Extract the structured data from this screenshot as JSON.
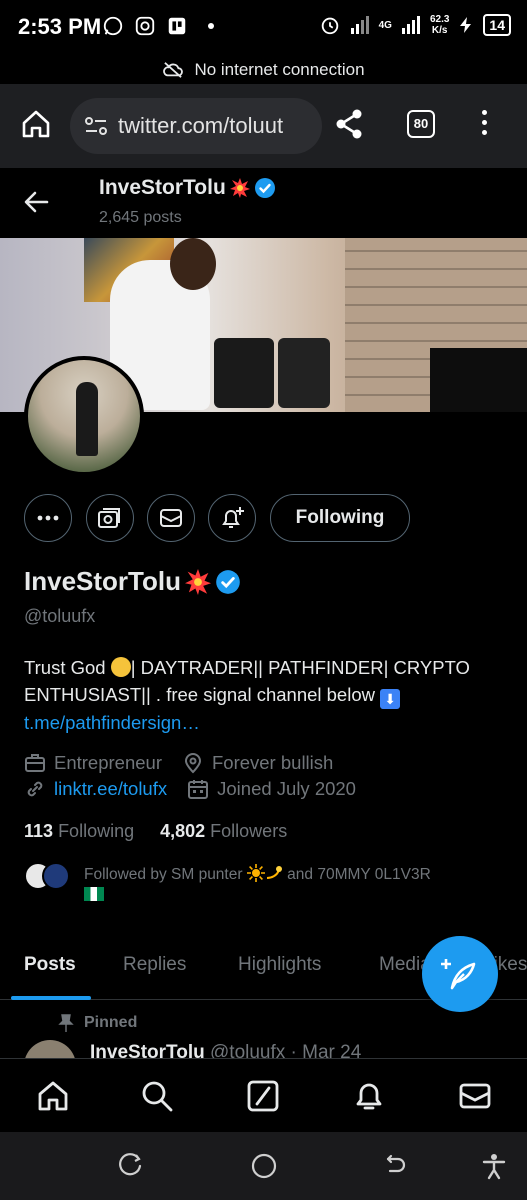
{
  "status_bar": {
    "time": "2:53 PM",
    "network_speed": "62.3",
    "network_unit": "K/s",
    "signal_label": "4G",
    "battery": "14"
  },
  "offline_banner": {
    "text": "No internet connection"
  },
  "browser": {
    "url": "twitter.com/toluut",
    "tab_count": "80"
  },
  "profile_header": {
    "name": "InveStorTolu",
    "posts_count": "2,645 posts"
  },
  "profile": {
    "name": "InveStorTolu",
    "handle": "@toluufx",
    "following_button": "Following",
    "bio_part1": "Trust God ",
    "bio_part2": "| DAYTRADER|| PATHFINDER| CRYPTO ENTHUSIAST|| . free signal channel below ",
    "bio_link": "t.me/pathfindersign…",
    "profession": "Entrepreneur",
    "location": "Forever bullish",
    "website": "linktr.ee/tolufx",
    "joined": "Joined July 2020",
    "following_count": "113",
    "following_label": "Following",
    "followers_count": "4,802",
    "followers_label": "Followers",
    "followed_by_text": "Followed by SM punter",
    "followed_by_and": " and 70MMY 0L1V3R"
  },
  "tabs": {
    "posts": "Posts",
    "replies": "Replies",
    "highlights": "Highlights",
    "media": "Media",
    "likes": "Likes"
  },
  "pinned": {
    "label": "Pinned",
    "author": "InveStorTolu",
    "meta": "@toluufx · Mar 24"
  },
  "colors": {
    "accent": "#1d9bf0",
    "background": "#000000",
    "muted": "#71767b"
  }
}
